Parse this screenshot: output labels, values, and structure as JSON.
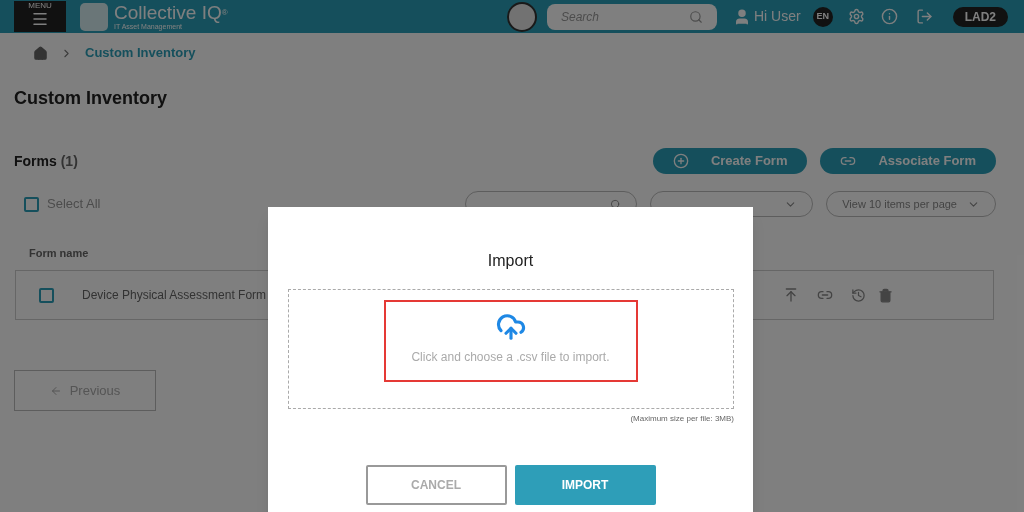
{
  "header": {
    "menu_label": "MENU",
    "brand": "Collective IQ",
    "brand_mark": "®",
    "tagline": "IT Asset Management",
    "search": {
      "placeholder": "Search"
    },
    "user": "Hi User",
    "language": "EN",
    "tenant": "LAD2"
  },
  "breadcrumb": [
    "Custom Inventory"
  ],
  "page_title": "Custom Inventory",
  "forms": {
    "title": "Forms",
    "count": "(1)",
    "actions": [
      {
        "label": "Create Form",
        "kind": "create"
      },
      {
        "label": "Associate Form",
        "kind": "associate"
      }
    ],
    "select_all": {
      "label": "Select All",
      "checked": false
    },
    "filters": [
      {
        "kind": "search"
      },
      {
        "kind": "dropdown"
      },
      {
        "value": "View 10 items per page",
        "kind": "dropdown"
      }
    ],
    "columns": [
      "Form name"
    ],
    "rows": [
      {
        "name": "Device Physical Assessment Form",
        "checked": false
      }
    ],
    "pager": [
      "Previous"
    ]
  },
  "dialog": {
    "title": "Import",
    "drop_text": "Click and choose a .csv file to import.",
    "size_note": "(Maximum size per file: 3MB)",
    "buttons": [
      {
        "label": "CANCEL",
        "kind": "secondary"
      },
      {
        "label": "IMPORT",
        "kind": "primary"
      }
    ]
  }
}
